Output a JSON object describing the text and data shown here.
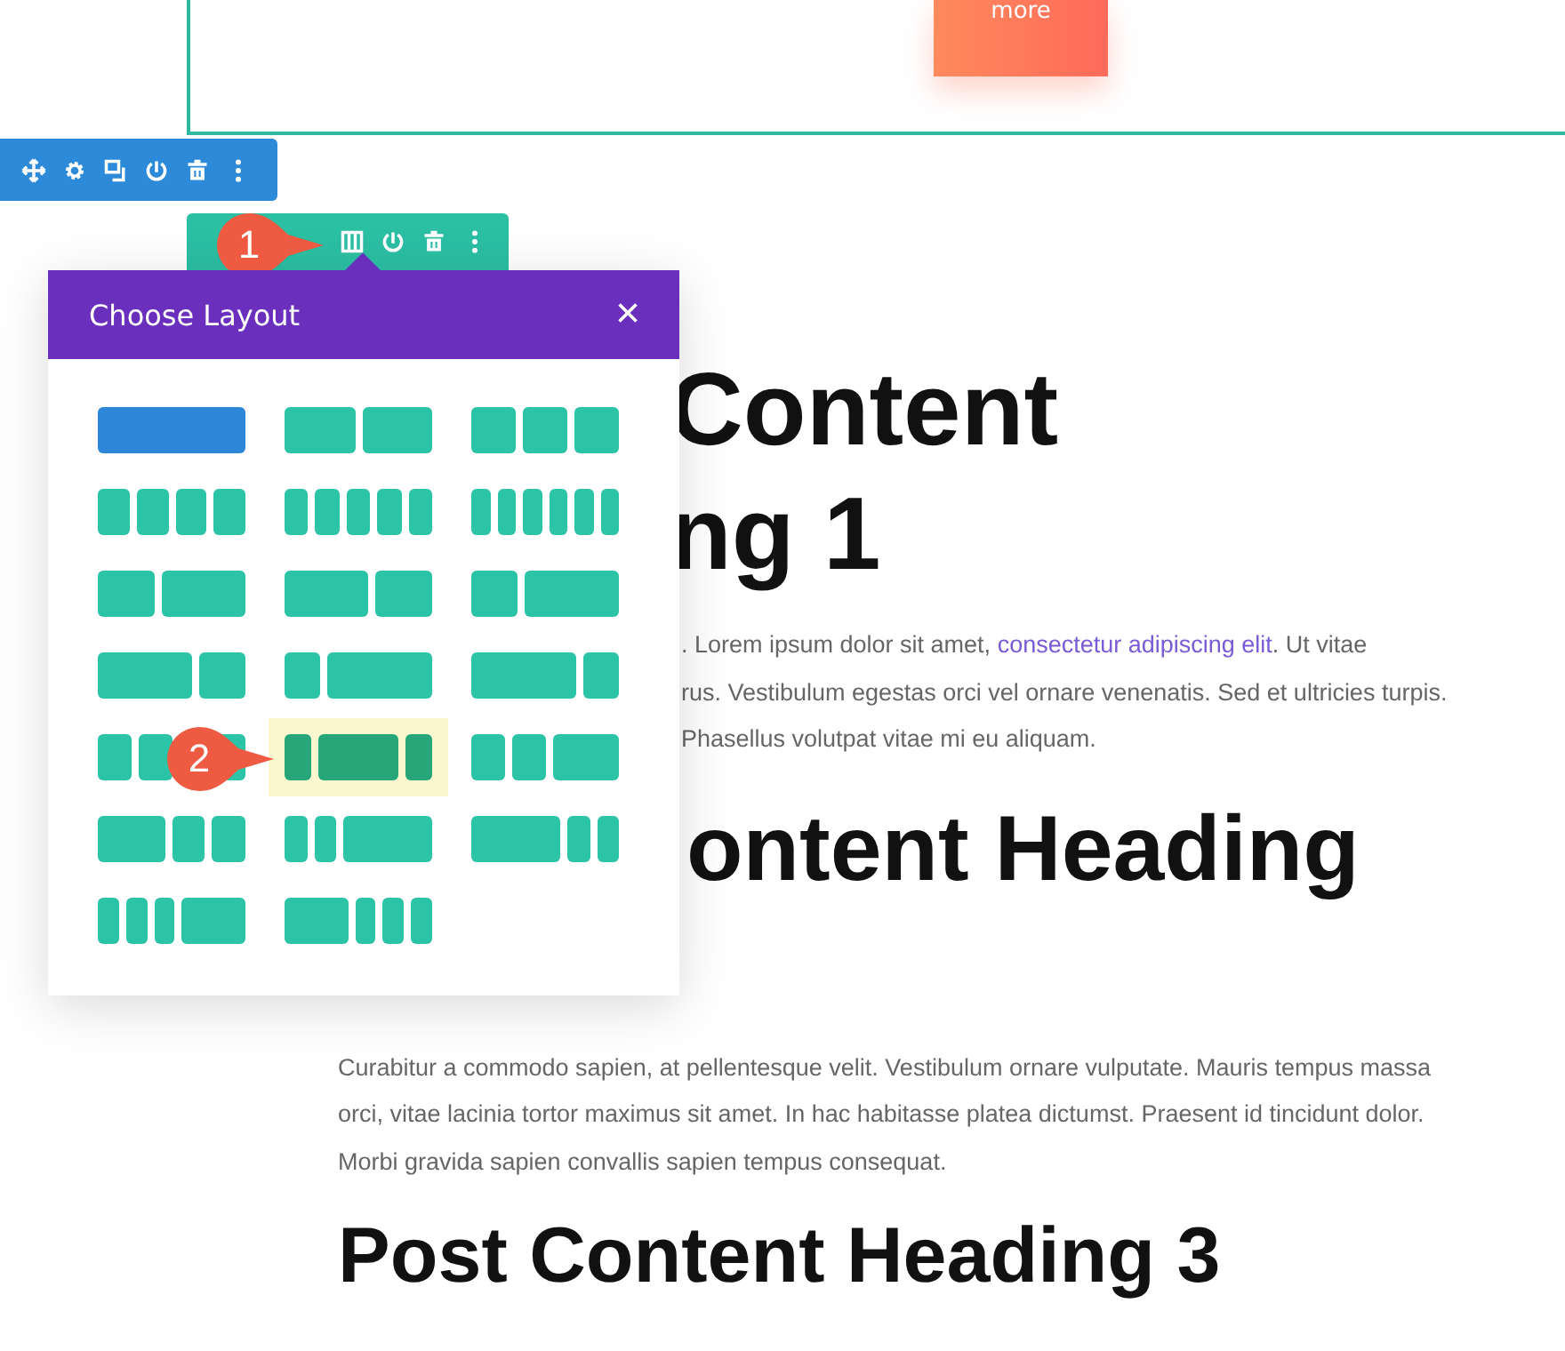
{
  "top_section": {
    "button": "more"
  },
  "markers": [
    {
      "label": "1"
    },
    {
      "label": "2"
    }
  ],
  "layout_modal": {
    "title": "Choose Layout",
    "close": "×",
    "layouts": [
      {
        "kind": "full",
        "current": true,
        "selected": false
      },
      {
        "kind": "halves",
        "current": false,
        "selected": false
      },
      {
        "kind": "thirds",
        "current": false,
        "selected": false
      },
      {
        "kind": "quarters",
        "current": false,
        "selected": false
      },
      {
        "kind": "fifths",
        "current": false,
        "selected": false
      },
      {
        "kind": "sixths",
        "current": false,
        "selected": false
      },
      {
        "kind": "twofifths-threefifths",
        "current": false,
        "selected": false
      },
      {
        "kind": "threefifths-twofifths",
        "current": false,
        "selected": false
      },
      {
        "kind": "third-twothirds",
        "current": false,
        "selected": false
      },
      {
        "kind": "twothirds-third",
        "current": false,
        "selected": false
      },
      {
        "kind": "quarter-threequarters",
        "current": false,
        "selected": false
      },
      {
        "kind": "threequarters-quarter",
        "current": false,
        "selected": false
      },
      {
        "kind": "quarter-quarter-half",
        "current": false,
        "selected": false
      },
      {
        "kind": "fifth-threefifths-fifth",
        "current": false,
        "selected": true
      },
      {
        "kind": "quarter-quarter-half",
        "current": false,
        "selected": false
      },
      {
        "kind": "half-quarter-quarter",
        "current": false,
        "selected": false
      },
      {
        "kind": "sixth-sixth-twothirds",
        "current": false,
        "selected": false
      },
      {
        "kind": "twothirds-sixth-sixth",
        "current": false,
        "selected": false
      },
      {
        "kind": "sixth-sixth-sixth-half",
        "current": false,
        "selected": false
      },
      {
        "kind": "half-sixth-sixth-sixth",
        "current": false,
        "selected": false
      }
    ]
  },
  "content": [
    {
      "kind": "heading-cut",
      "text": "Content"
    },
    {
      "kind": "heading-cut",
      "text": "ng 1"
    },
    {
      "kind": "line-link",
      "text": ". Lorem ipsum dolor sit amet, ",
      "link": "consectetur adipiscing elit",
      "after": ". Ut vitae"
    },
    {
      "kind": "line-cut",
      "text": "rus. Vestibulum egestas orci vel ornare venenatis. Sed et ultricies turpis."
    },
    {
      "kind": "line-cut",
      "text": "Phasellus volutpat vitae mi eu aliquam."
    },
    {
      "kind": "heading2-cut",
      "text": "ontent Heading"
    },
    {
      "kind": "paragraph",
      "text": "Curabitur a commodo sapien, at pellentesque velit. Vestibulum ornare vulputate. Mauris tempus massa orci, vitae lacinia tortor maximus sit amet. In hac habitasse platea dictumst. Praesent id tincidunt dolor. Morbi gravida sapien convallis sapien tempus consequat."
    },
    {
      "kind": "heading",
      "text": "Post Content Heading 3"
    }
  ]
}
